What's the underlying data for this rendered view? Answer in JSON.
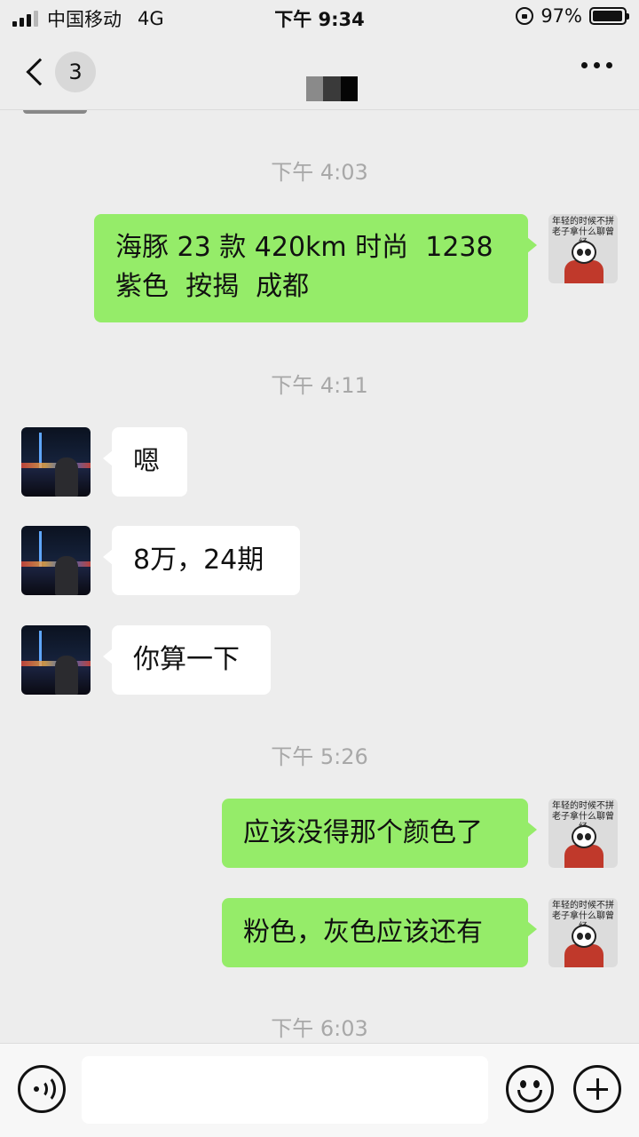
{
  "status_bar": {
    "carrier": "中国移动",
    "network": "4G",
    "time": "下午 9:34",
    "battery_percent": "97%",
    "battery_level": 0.97
  },
  "nav": {
    "unread_count": "3",
    "back_icon": "chevron-left-icon",
    "more_icon": "more-dots-icon"
  },
  "me_avatar_text": "年轻的时候不拼 老子拿什么聊曾经",
  "messages": [
    {
      "type": "time",
      "text": "下午 4:03"
    },
    {
      "type": "me",
      "lines": [
        "海豚 23 款 420km 时尚  1238",
        "紫色  按揭  成都"
      ]
    },
    {
      "type": "time",
      "text": "下午 4:11"
    },
    {
      "type": "them",
      "text": "嗯"
    },
    {
      "type": "them",
      "text": "8万，24期"
    },
    {
      "type": "them",
      "text": "你算一下"
    },
    {
      "type": "time",
      "text": "下午 5:26"
    },
    {
      "type": "me",
      "text": "应该没得那个颜色了"
    },
    {
      "type": "me",
      "text": "粉色，灰色应该还有"
    },
    {
      "type": "time",
      "text": "下午 6:03"
    }
  ],
  "input_bar": {
    "voice_icon": "voice-icon",
    "input_value": "",
    "emoji_icon": "emoji-icon",
    "plus_icon": "plus-icon"
  },
  "colors": {
    "my_bubble": "#95ec69",
    "their_bubble": "#ffffff",
    "background": "#ededed",
    "timestamp": "#a8a8a8"
  }
}
